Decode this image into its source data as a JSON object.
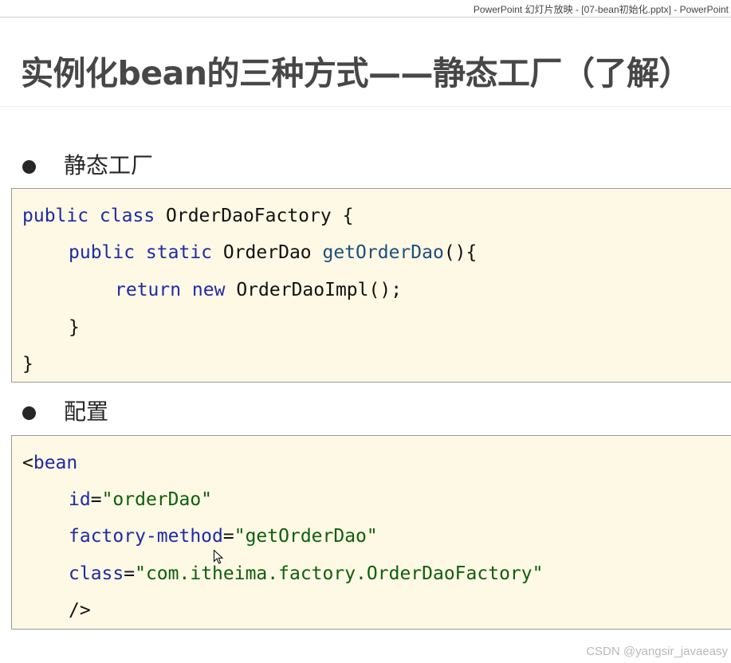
{
  "window": {
    "title": "PowerPoint 幻灯片放映 - [07-bean初始化.pptx] - PowerPoint"
  },
  "slide": {
    "title": "实例化bean的三种方式——静态工厂（了解）",
    "sections": [
      {
        "bullet": "静态工厂",
        "code": [
          [
            [
              "kw",
              "public class"
            ],
            [
              "plain",
              " OrderDaoFactory {"
            ]
          ],
          [
            [
              "kw",
              "public static"
            ],
            [
              "plain",
              " OrderDao "
            ],
            [
              "fn",
              "getOrderDao"
            ],
            [
              "plain",
              "(){"
            ]
          ],
          [
            [
              "kw",
              "return new"
            ],
            [
              "plain",
              " OrderDaoImpl();"
            ]
          ],
          [
            [
              "plain",
              "}"
            ]
          ],
          [
            [
              "plain",
              "}"
            ]
          ]
        ]
      },
      {
        "bullet": "配置",
        "code": [
          [
            [
              "plain",
              "<"
            ],
            [
              "kw",
              "bean"
            ]
          ],
          [
            [
              "attr",
              "id"
            ],
            [
              "plain",
              "="
            ],
            [
              "str",
              "\"orderDao\""
            ]
          ],
          [
            [
              "attr",
              "factory-method"
            ],
            [
              "plain",
              "="
            ],
            [
              "str",
              "\"getOrderDao\""
            ]
          ],
          [
            [
              "attr",
              "class"
            ],
            [
              "plain",
              "="
            ],
            [
              "str",
              "\"com.itheima.factory.OrderDaoFactory\""
            ]
          ],
          [
            [
              "plain",
              "/>"
            ]
          ]
        ]
      }
    ]
  },
  "watermark": "CSDN @yangsir_javaeasy",
  "icons": [
    "bullet-dot-icon",
    "mouse-pointer-icon"
  ],
  "colors": {
    "code_background": "#fdf9e4",
    "keyword": "#1f2aa6",
    "string": "#0e5e0e",
    "method": "#1c4f7c",
    "title": "#474747"
  }
}
